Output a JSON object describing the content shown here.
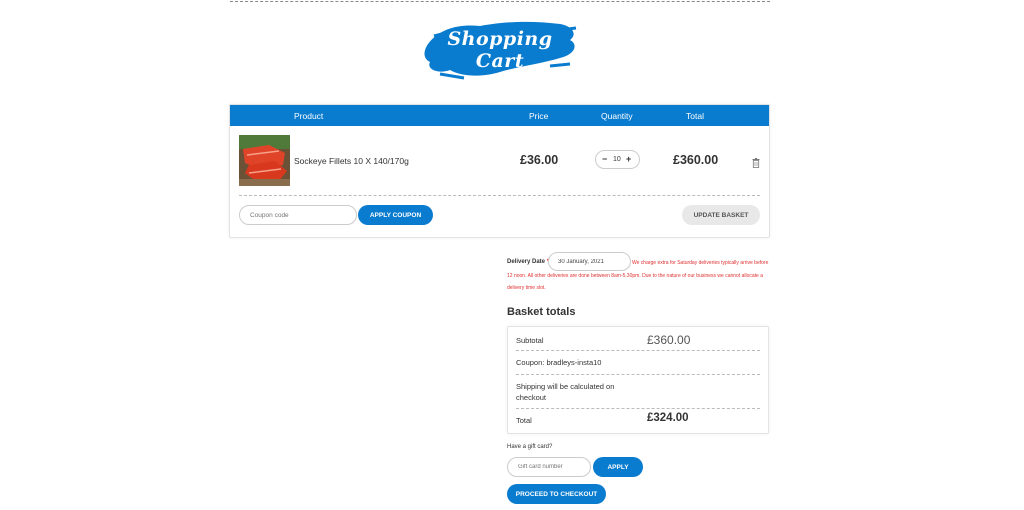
{
  "logo": {
    "text": "Shopping Cart",
    "brush_color": "#0a7ccf"
  },
  "cart": {
    "headers": {
      "product": "Product",
      "price": "Price",
      "quantity": "Quantity",
      "total": "Total"
    },
    "item": {
      "name": "Sockeye Fillets 10 X 140/170g",
      "price": "£36.00",
      "quantity": "10",
      "minus_symbol": "−",
      "plus_symbol": "+",
      "total": "£360.00",
      "remove_icon": "trash-icon"
    },
    "coupon_placeholder": "Coupon code",
    "apply_coupon_label": "APPLY COUPON",
    "update_basket_label": "UPDATE BASKET"
  },
  "delivery": {
    "label": "Delivery Date",
    "required_mark": "*",
    "date_value": "30 January, 2021",
    "note": "We charge extra for Saturday deliveries typically arrive before 12 noon. All other deliveries are done between 8am-5.30pm. Due to the nature of our business we cannot allocate a delivery time slot."
  },
  "basket_totals": {
    "title": "Basket totals",
    "subtotal_label": "Subtotal",
    "subtotal_value": "£360.00",
    "coupon_label": "Coupon: bradleys-insta10",
    "shipping_text": "Shipping will be calculated on checkout",
    "total_label": "Total",
    "total_value": "£324.00"
  },
  "gift_card": {
    "label": "Have a gift card?",
    "placeholder": "Gift card number",
    "apply_label": "APPLY"
  },
  "checkout_label": "PROCEED TO CHECKOUT",
  "colors": {
    "accent": "#0a7ccf",
    "warning": "#e03030"
  }
}
